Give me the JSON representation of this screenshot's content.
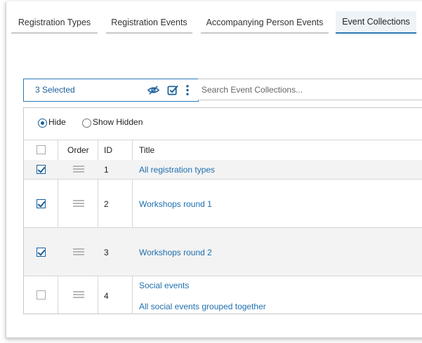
{
  "tabs": [
    {
      "label": "Registration Types",
      "active": false
    },
    {
      "label": "Registration Events",
      "active": false
    },
    {
      "label": "Accompanying Person Events",
      "active": false
    },
    {
      "label": "Event Collections",
      "active": true
    }
  ],
  "toolbar": {
    "selected_label": "3 Selected",
    "search_placeholder": "Search Event Collections..."
  },
  "filter": {
    "hide_label": "Hide",
    "show_hidden_label": "Show Hidden",
    "selected": "Hide"
  },
  "table": {
    "columns": [
      "Order",
      "ID",
      "Title"
    ],
    "rows": [
      {
        "checked": true,
        "id": "1",
        "title": "All registration types",
        "description": ""
      },
      {
        "checked": true,
        "id": "2",
        "title": "Workshops round 1",
        "description": ""
      },
      {
        "checked": true,
        "id": "3",
        "title": "Workshops round 2",
        "description": ""
      },
      {
        "checked": false,
        "id": "4",
        "title": "Social events",
        "description": "All social events grouped together"
      }
    ]
  },
  "colors": {
    "accent": "#1a5f99",
    "link": "#1f6fae"
  }
}
